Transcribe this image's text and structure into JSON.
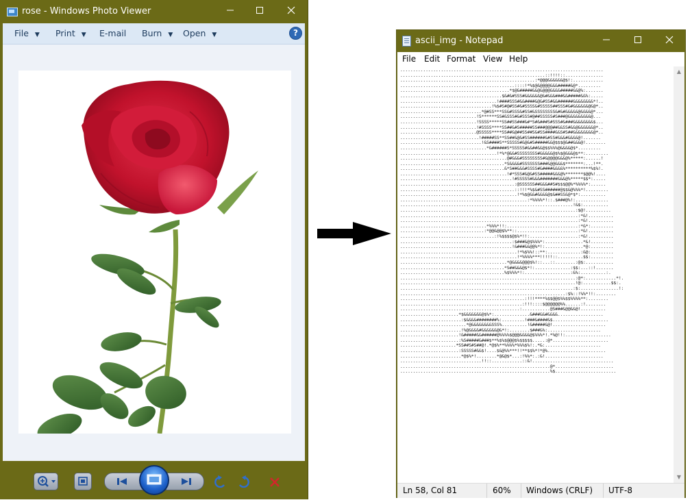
{
  "photo_viewer": {
    "title": "rose - Windows Photo Viewer",
    "menu": {
      "file": "File",
      "print": "Print",
      "email": "E-mail",
      "burn": "Burn",
      "open": "Open"
    },
    "help_glyph": "?",
    "image_subject": "red rose on white background",
    "toolbar_icons": [
      "zoom-icon",
      "actual-size-icon",
      "previous-icon",
      "slideshow-icon",
      "next-icon",
      "rotate-ccw-icon",
      "rotate-cw-icon",
      "delete-icon"
    ]
  },
  "notepad": {
    "title": "ascii_img - Notepad",
    "menu": {
      "file": "File",
      "edit": "Edit",
      "format": "Format",
      "view": "View",
      "help": "Help"
    },
    "status": {
      "position": "Ln 58, Col 81",
      "zoom": "60%",
      "line_ending": "Windows (CRLF)",
      "encoding": "UTF-8"
    },
    "ascii_text": "................................................................................\n.........................................................::!!!!::...............\n.....................................................:*@@@&&&&&&@$!:............\n.............................................::::!*%$@&@@@@&&&#####&@*.........\n...........................................*$@&#####&&@&@@@&&&&#####&&@%:.......\n........................................$&#&#SSS#&&&&&&@&#&&&###&&#####&&%:.....\n......................................!####SSS#&&####&@&#SS#&&######&&&&&&&&*!..\n....................................!%$#S#@#SS#&#SSSS&#SSSSS##SSS#&#&&&&&&@&@*..\n................................*@#SS***SS&#SSS&#SS#&SSSSSSSS&#&#&&&&&@&&&&@*...\n..............................!S******SS#&SSS#&#SSS#@##SSSSS#S###@&&&&&&&&&@...\n..............................!SSSS*****SS##SS###&#*S#&###S#SSS#&###&&&&&&&&$...\n..............................!#SSSS****SS##&#S#####SS###@@@##&&SS#&&@&&&&&&@*..\n..............................@SSSSS****SS##&@##SS##S&#SS####&&S#S##&&&&&&&&@*..\n...............................!#####SS**SS##&@&#SS######&#SS#&&&#&&&&@!.......\n................................!&S####S**SSSSS#&@&#S#####&&@$$$@&##&&&@!........\n..................................*&######S*SSSSS#&&##&&@$$%%%@&&&&@$*.........\n......................................!*%*@&&#SSSSSSSS#&&&&&@$%$@&&&@$**:.........\n..........................................@#&&&#SSSSSSSS#&@@@@&&&@%*****:......!\n.........................................*S&&&&#SSSSSSS###&@@&&&$*******:...!**.\n.........................................&*S##&&&#SSSS#&####&&&&%**********%$%!.\n..........................................!#*SSS#&@&#SS#####&&&@%*******$@@%!....\n............................................!#SSSSS#&&&#######&&&@%*****$$*:.....\n.............................................:@SSSSSS##&&&##S#$$$@@%*%%%%*:......\n.............................................::!!!*%$&#SS######@$$&@%%%*!.........\n..............................................!*%$@&&#&&&&@$&##SS&@*$*:..........\n..................................................:*%%%%*!::.$###@%!:.............\n....................................................................!&$:..........\n.....................................................................:$@!..........\n......................................................................:*&!..........\n......................................................................:*&!..........\n..................................*%%%*!!:............................:*&*:.........\n.................................:*@@&@@$%**::........................:*&!..........\n.....................................:!%$$$$@$%*!!:...................:*&!..........\n............................................:$###&@$%%%*:...............*&!.........\n............................................!&###&&@@%*!:...............*@:.........\n..............................................!*%$%%!::**:.............:&@:.........\n..............................................!*%%%%***!!!!!::..........$$:.........\n..........................................*@&&&&@@@$%!::...::........:@$:...........\n.........................................*S##&&&@$*!:..............:$$:...::!.......\n.........................................%$%%%*!:..................:&%:..........:.\n.....................................................................:@*:............*!.\n.....................................................................!@:...........$$:.\n....................................................................:$:...............!:\n.................................................................:$%::!%%*!!:........\n.................................................:!!!****%$$@@$%%$$%%%%**:........\n................................................:!!!::::$@@@@@@%%......:!........\n...............................................:...........@S###&@@&&@!..........\n.......................*$&&&&&&&@$%*:..............&###&&#&&&&..................\n........................:$&&&&########%:.........!###&####&$......................\n..........................*@&&&&&&&&SSS%..........!&#####&@!.....................\n........................!%@&&&&#&&&&&&@&*!:........$###&%:.....................\n.......................!&#####&&######@%%%%$@@@&&&&@$%%%*!.*%@!!:..................\n.......................:%S#####&###$**%$%$@@@$%$$$$$.....:@*......................\n......................*SS##S#S##@!.*@$%**%%%%*%%%$%!:.*&:......................\n.......................:SSSSS#&&$!....$&@%%***!!**$$%*!*@%.......................\n........................*@$%*!........*@&@$*...:!%%*:.:&!.......................\n................................!!::............::&!................................\n...........................................................@*.......................\n...........................................................%$........................"
  }
}
